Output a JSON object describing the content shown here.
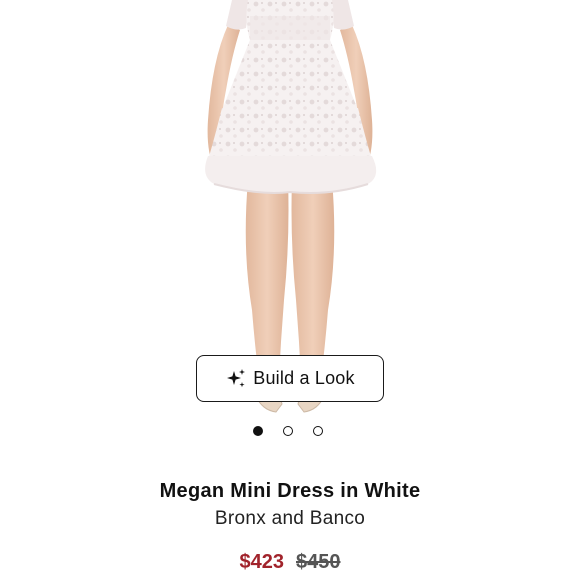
{
  "product": {
    "image_alt": "Model wearing white lace mini dress",
    "build_look_label": "Build a Look",
    "title": "Megan Mini Dress in White",
    "brand": "Bronx and Banco",
    "price_sale": "$423",
    "price_original": "$450"
  },
  "carousel": {
    "count": 3,
    "active_index": 0
  },
  "colors": {
    "sale_price": "#a1232b",
    "text": "#111111",
    "dress": "#f3ecec",
    "skin": "#e9c6ad"
  },
  "icons": {
    "build_look": "sparkle-icon"
  }
}
